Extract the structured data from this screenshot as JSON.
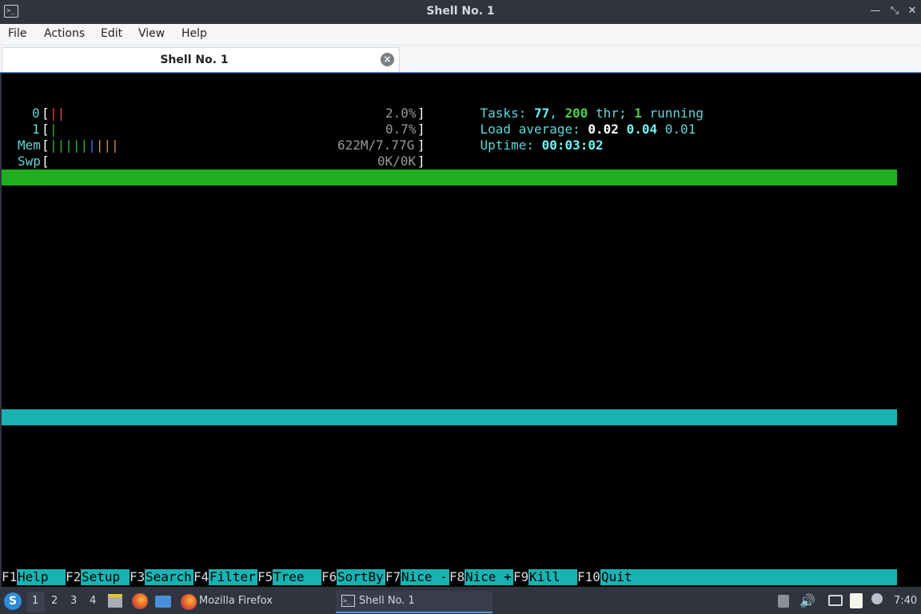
{
  "window": {
    "title": "Shell No. 1",
    "minimize_icon": "—",
    "restore_icon": "⤡",
    "close_icon": "✕"
  },
  "menu": [
    "File",
    "Actions",
    "Edit",
    "View",
    "Help"
  ],
  "tab": {
    "label": "Shell No. 1",
    "close_icon": "×"
  },
  "htop": {
    "cpu0": {
      "label": "0",
      "bars": "||",
      "value": "2.0%"
    },
    "cpu1": {
      "label": "1",
      "bars": "|",
      "value": "0.7%"
    },
    "mem": {
      "label": "Mem",
      "bars": "|||||||||",
      "value": "622M/7.77G"
    },
    "swp": {
      "label": "Swp",
      "value": "0K/0K"
    },
    "tasks": {
      "label": "Tasks: ",
      "count": "77",
      "sep": ", ",
      "threads": "200",
      "thr_label": " thr; ",
      "running": "1",
      "running_label": " running"
    },
    "load": {
      "label": "Load average: ",
      "v1": "0.02",
      "v2": "0.04",
      "v3": "0.01"
    },
    "uptime": {
      "label": "Uptime: ",
      "value": "00:03:02"
    },
    "fkeys": [
      {
        "key": "F1",
        "label": "Help  "
      },
      {
        "key": "F2",
        "label": "Setup "
      },
      {
        "key": "F3",
        "label": "Search"
      },
      {
        "key": "F4",
        "label": "Filter"
      },
      {
        "key": "F5",
        "label": "Tree  "
      },
      {
        "key": "F6",
        "label": "SortBy"
      },
      {
        "key": "F7",
        "label": "Nice -"
      },
      {
        "key": "F8",
        "label": "Nice +"
      },
      {
        "key": "F9",
        "label": "Kill  "
      },
      {
        "key": "F10",
        "label": "Quit"
      }
    ]
  },
  "taskbar": {
    "workspaces": [
      "1",
      "2",
      "3",
      "4"
    ],
    "tasks": [
      {
        "label": "Mozilla Firefox",
        "icon": "firefox-icon"
      },
      {
        "label": "Shell No. 1",
        "icon": "terminal-icon"
      }
    ],
    "clock": "7:40"
  },
  "colors": {
    "titlebar": "#2f343f",
    "terminal_bg": "#000000",
    "header_bar": "#1fae1f",
    "footer_bar": "#19b2b2",
    "accent": "#5294e2"
  }
}
